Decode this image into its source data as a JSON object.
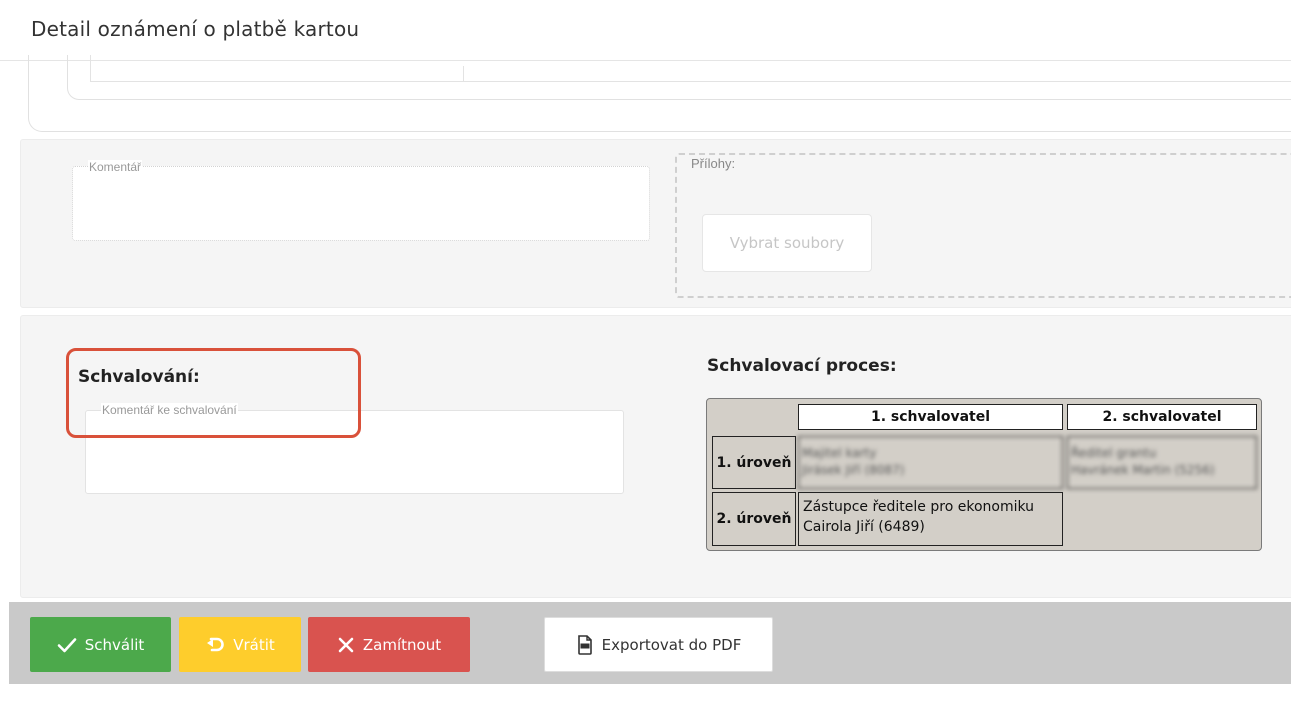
{
  "page": {
    "title": "Detail oznámení o platbě kartou"
  },
  "comment": {
    "label": "Komentář"
  },
  "attachments": {
    "label": "Přílohy:",
    "choose_button": "Vybrat soubory"
  },
  "approval": {
    "heading": "Schvalování:",
    "comment_label": "Komentář ke schvalování"
  },
  "process": {
    "heading": "Schvalovací proces:",
    "columns": [
      "1. schvalovatel",
      "2. schvalovatel"
    ],
    "rows": [
      {
        "level": "1. úroveň",
        "approver1_line1": "Majitel karty",
        "approver1_line2": "Jirásek Jiří (8087)",
        "approver2_line1": "Ředitel grantu",
        "approver2_line2": "Havránek Martin (5256)"
      },
      {
        "level": "2. úroveň",
        "approver1_line1": "Zástupce ředitele pro ekonomiku",
        "approver1_line2": "Cairola Jiří (6489)",
        "approver2_line1": "",
        "approver2_line2": ""
      }
    ]
  },
  "toolbar": {
    "approve_label": "Schválit",
    "return_label": "Vrátit",
    "reject_label": "Zamítnout",
    "export_label": "Exportovat do PDF"
  },
  "colors": {
    "approve": "#4ca94b",
    "return": "#fecd2c",
    "reject": "#d9534f",
    "highlight": "#d9513a",
    "table_bg": "#d3cfc8"
  },
  "icons": {
    "approve": "check-icon",
    "return": "undo-icon",
    "reject": "close-icon",
    "export": "pdf-icon"
  }
}
